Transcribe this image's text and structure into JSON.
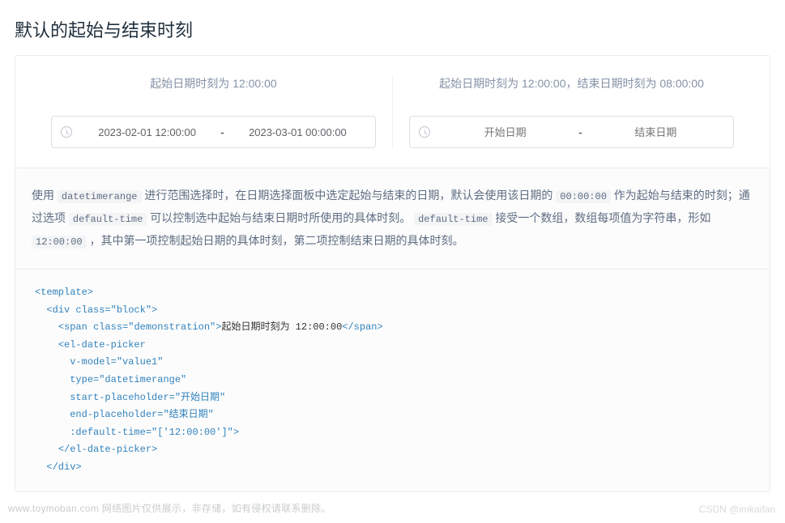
{
  "heading": "默认的起始与结束时刻",
  "blocks": [
    {
      "demonstration": "起始日期时刻为 12:00:00",
      "start_value": "2023-02-01 12:00:00",
      "end_value": "2023-03-01 00:00:00",
      "separator": "-",
      "has_value": true,
      "start_placeholder": "开始日期",
      "end_placeholder": "结束日期"
    },
    {
      "demonstration": "起始日期时刻为 12:00:00，结束日期时刻为 08:00:00",
      "start_value": "",
      "end_value": "",
      "separator": "-",
      "has_value": false,
      "start_placeholder": "开始日期",
      "end_placeholder": "结束日期"
    }
  ],
  "description": {
    "t0": "使用 ",
    "c0": "datetimerange",
    "t1": " 进行范围选择时，在日期选择面板中选定起始与结束的日期，默认会使用该日期的 ",
    "c1": "00:00:00",
    "t2": " 作为起始与结束的时刻；通过选项 ",
    "c2": "default-time",
    "t3": " 可以控制选中起始与结束日期时所使用的具体时刻。 ",
    "c3": "default-time",
    "t4": " 接受一个数组，数组每项值为字符串，形如 ",
    "c4": "12:00:00",
    "t5": " ，其中第一项控制起始日期的具体时刻，第二项控制结束日期的具体时刻。"
  },
  "code": {
    "line1": "<template>",
    "line2_open": "<div",
    "line2_attr": " class=\"block\"",
    "line2_close": ">",
    "line3_open": "<span",
    "line3_attr": " class=\"demonstration\"",
    "line3_close": ">",
    "line3_text": "起始日期时刻为 12:00:00",
    "line3_end": "</span>",
    "line4": "<el-date-picker",
    "line5": "v-model=\"value1\"",
    "line6": "type=\"datetimerange\"",
    "line7": "start-placeholder=\"开始日期\"",
    "line8": "end-placeholder=\"结束日期\"",
    "line9": ":default-time=\"['12:00:00']\"",
    "line9_close": ">",
    "line10": "</el-date-picker>",
    "line11": "</div>"
  },
  "watermark_left": "www.toymoban.com 网络图片仅供展示，非存储，如有侵权请联系删除。",
  "watermark_right": "CSDN @imkaifan"
}
